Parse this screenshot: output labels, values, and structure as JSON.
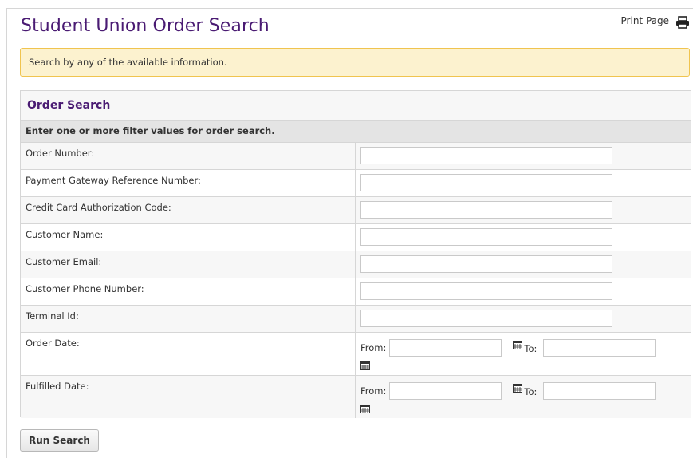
{
  "page": {
    "title": "Student Union Order Search",
    "print_label": "Print Page",
    "notice": "Search by any of the available information."
  },
  "panel": {
    "title": "Order Search",
    "subtitle": "Enter one or more filter values for order search."
  },
  "fields": [
    {
      "label": "Order Number:",
      "value": ""
    },
    {
      "label": "Payment Gateway Reference Number:",
      "value": ""
    },
    {
      "label": "Credit Card Authorization Code:",
      "value": ""
    },
    {
      "label": "Customer Name:",
      "value": ""
    },
    {
      "label": "Customer Email:",
      "value": ""
    },
    {
      "label": "Customer Phone Number:",
      "value": ""
    },
    {
      "label": "Terminal Id:",
      "value": ""
    }
  ],
  "date_fields": [
    {
      "label": "Order Date:",
      "from_label": "From:",
      "to_label": "To:",
      "from_value": "",
      "to_value": ""
    },
    {
      "label": "Fulfilled Date:",
      "from_label": "From:",
      "to_label": "To:",
      "from_value": "",
      "to_value": ""
    }
  ],
  "actions": {
    "run_search": "Run Search"
  },
  "colors": {
    "title": "#4a1b73",
    "notice_bg": "#fcf2cf",
    "notice_border": "#f0c44f"
  },
  "icons": {
    "print": "printer-icon",
    "calendar": "calendar-icon"
  }
}
